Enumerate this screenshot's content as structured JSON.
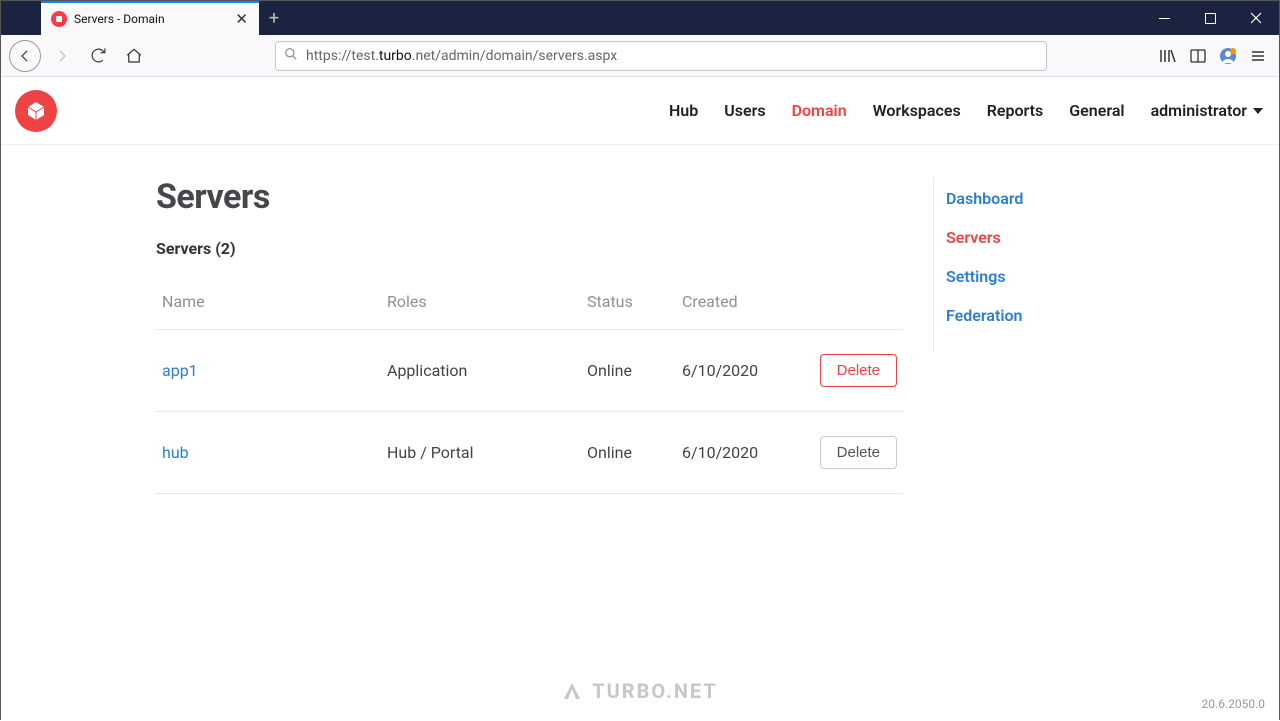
{
  "browser": {
    "tab_title": "Servers - Domain",
    "url_prefix": "https://test.",
    "url_domain": "turbo",
    "url_suffix": ".net/admin/domain/servers.aspx"
  },
  "nav": {
    "links": [
      "Hub",
      "Users",
      "Domain",
      "Workspaces",
      "Reports",
      "General"
    ],
    "active": "Domain",
    "user": "administrator"
  },
  "page": {
    "title": "Servers",
    "subhead": "Servers (2)"
  },
  "table": {
    "headers": {
      "name": "Name",
      "roles": "Roles",
      "status": "Status",
      "created": "Created"
    },
    "rows": [
      {
        "name": "app1",
        "roles": "Application",
        "status": "Online",
        "created": "6/10/2020",
        "action": "Delete",
        "danger": true
      },
      {
        "name": "hub",
        "roles": "Hub / Portal",
        "status": "Online",
        "created": "6/10/2020",
        "action": "Delete",
        "danger": false
      }
    ]
  },
  "sidebar": {
    "items": [
      "Dashboard",
      "Servers",
      "Settings",
      "Federation"
    ],
    "active": "Servers"
  },
  "footer": {
    "brand": "TURBO.NET",
    "version": "20.6.2050.0"
  }
}
